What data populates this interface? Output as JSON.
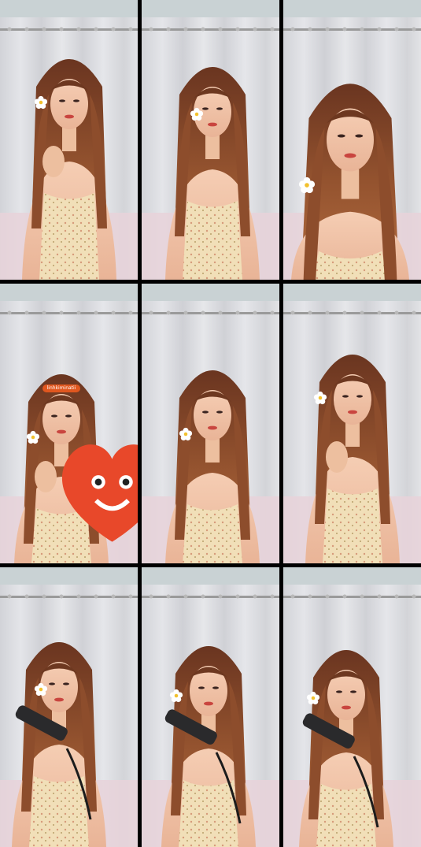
{
  "collage": {
    "columns": 3,
    "rows": 3,
    "tiles": [
      {
        "id": 1,
        "subject": "woman-hand-near-chest",
        "flower": true,
        "hair_tool": false,
        "sticker": false
      },
      {
        "id": 2,
        "subject": "woman-hand-on-head",
        "flower": true,
        "hair_tool": false,
        "sticker": false
      },
      {
        "id": 3,
        "subject": "woman-closeup-smiling",
        "flower": true,
        "hair_tool": false,
        "sticker": false
      },
      {
        "id": 4,
        "subject": "woman-finger-on-lip",
        "flower": true,
        "hair_tool": false,
        "sticker": true
      },
      {
        "id": 5,
        "subject": "woman-smiling",
        "flower": true,
        "hair_tool": false,
        "sticker": false
      },
      {
        "id": 6,
        "subject": "woman-gesturing",
        "flower": true,
        "hair_tool": false,
        "sticker": false
      },
      {
        "id": 7,
        "subject": "woman-holding-hair-straightener",
        "flower": true,
        "hair_tool": true,
        "sticker": false
      },
      {
        "id": 8,
        "subject": "woman-straightening-hair",
        "flower": true,
        "hair_tool": true,
        "sticker": false
      },
      {
        "id": 9,
        "subject": "woman-straightening-hair-side",
        "flower": true,
        "hair_tool": true,
        "sticker": false
      }
    ]
  },
  "sticker": {
    "icon": "heart-emoji-icon",
    "label": "linhkiminatii"
  },
  "colors": {
    "curtain": "#d7d8dc",
    "wall": "#c9d2d4",
    "hair": "#8a4a2b",
    "skin": "#f0c3a8",
    "dress": "#f0dcb4",
    "sticker_orange": "#e0571f"
  }
}
